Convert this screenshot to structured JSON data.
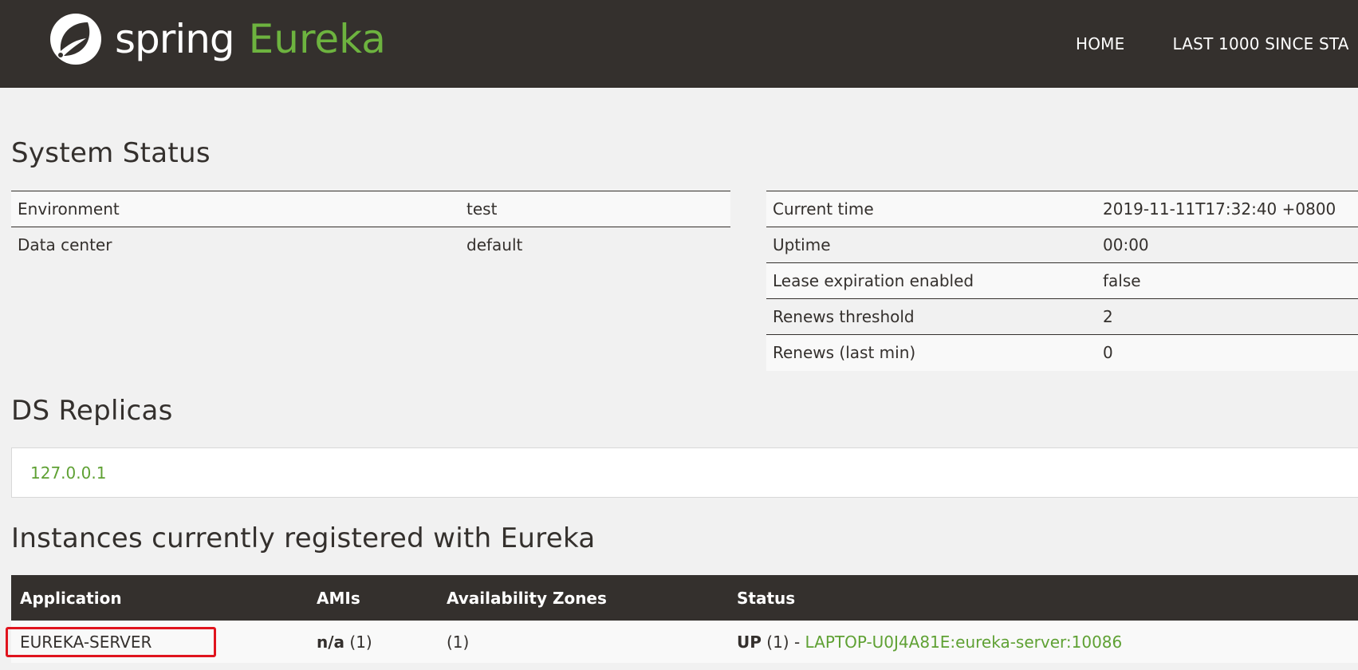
{
  "navbar": {
    "brand_spring": "spring",
    "brand_eureka": "Eureka",
    "logo_icon": "spring-leaf-icon",
    "links": [
      "HOME",
      "LAST 1000 SINCE STA"
    ]
  },
  "system_status": {
    "title": "System Status",
    "left": [
      {
        "key": "Environment",
        "value": "test"
      },
      {
        "key": "Data center",
        "value": "default"
      }
    ],
    "right": [
      {
        "key": "Current time",
        "value": "2019-11-11T17:32:40 +0800"
      },
      {
        "key": "Uptime",
        "value": "00:00"
      },
      {
        "key": "Lease expiration enabled",
        "value": "false"
      },
      {
        "key": "Renews threshold",
        "value": "2"
      },
      {
        "key": "Renews (last min)",
        "value": "0"
      }
    ]
  },
  "ds_replicas": {
    "title": "DS Replicas",
    "items": [
      "127.0.0.1"
    ]
  },
  "instances": {
    "title": "Instances currently registered with Eureka",
    "headers": [
      "Application",
      "AMIs",
      "Availability Zones",
      "Status"
    ],
    "rows": [
      {
        "application": "EUREKA-SERVER",
        "ami_bold": "n/a",
        "ami_count": "(1)",
        "zones": "(1)",
        "status_bold": "UP",
        "status_count": "(1) -",
        "status_link": "LAPTOP-U0J4A81E:eureka-server:10086"
      }
    ]
  },
  "colors": {
    "navbar_bg": "#34302d",
    "brand_green": "#6db33f",
    "link_green": "#5fa134",
    "highlight_red": "#e0141e"
  }
}
